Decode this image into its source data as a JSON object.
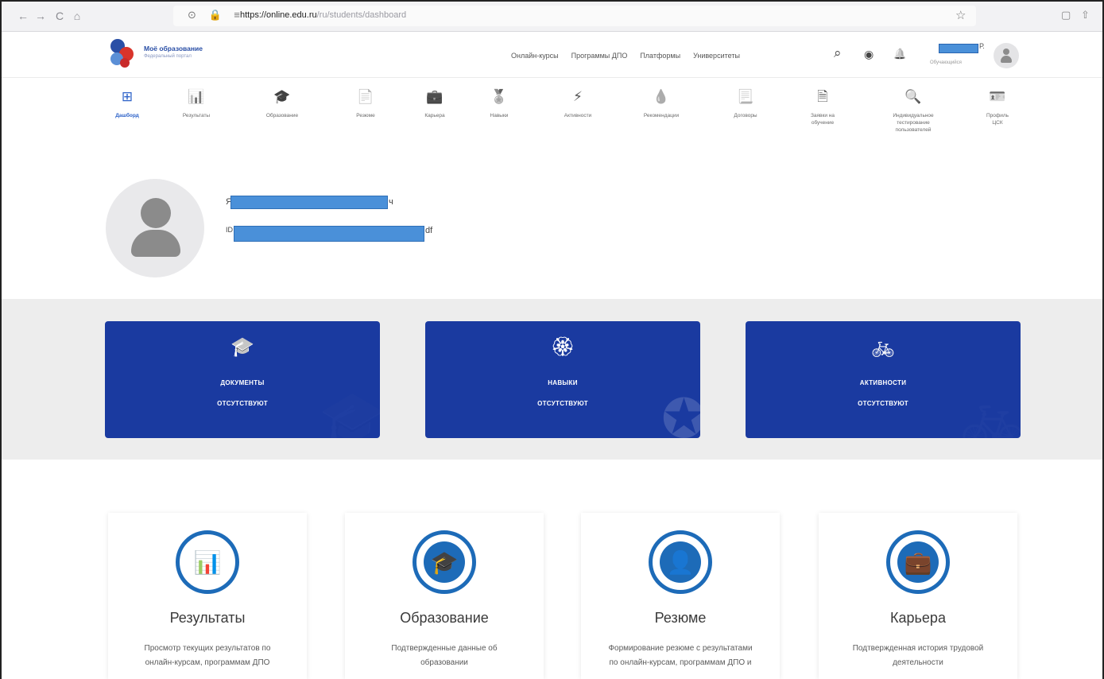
{
  "browser": {
    "back": "←",
    "forward": "→",
    "reload": "C",
    "home": "⌂",
    "url_lock": "⊙ 🔒 ≡",
    "url_host": "https://online.edu.ru",
    "url_path": "/ru/students/dashboard",
    "star": "☆",
    "ext1": "▢",
    "ext2": "⇧"
  },
  "header": {
    "logo_title": "Моё образование",
    "logo_subtitle": "Федеральный портал",
    "links": [
      "Онлайн-курсы",
      "Программы ДПО",
      "Платформы",
      "Университеты"
    ],
    "search_icon": "⌕",
    "eye_icon": "◉",
    "bell_icon": "🔔",
    "user_tail": "Р.",
    "user_role": "Обучающийся"
  },
  "tabs": [
    {
      "icon": "⊞",
      "label": "Дашборд",
      "active": true
    },
    {
      "icon": "📊",
      "label": "Результаты"
    },
    {
      "icon": "🎓",
      "label": "Образование"
    },
    {
      "icon": "📄",
      "label": "Резюме"
    },
    {
      "icon": "💼",
      "label": "Карьера"
    },
    {
      "icon": "🏅",
      "label": "Навыки"
    },
    {
      "icon": "⚡",
      "label": "Активности"
    },
    {
      "icon": "💧",
      "label": "Рекомендации"
    },
    {
      "icon": "📃",
      "label": "Договоры"
    },
    {
      "icon": "🗎",
      "label": "Заявки на обучение"
    },
    {
      "icon": "🔍",
      "label": "Индивидуальное тестирование пользователей"
    },
    {
      "icon": "🪪",
      "label": "Профиль ЦСК"
    }
  ],
  "profile": {
    "name_prefix": "Я",
    "name_suffix": "ч",
    "id_prefix": "ID",
    "id_suffix": "df"
  },
  "blue_cards": [
    {
      "icon": "🎓",
      "line1": "ДОКУМЕНТЫ",
      "line2": "ОТСУТСТВУЮТ",
      "ghost": "🎓"
    },
    {
      "icon": "🏵",
      "line1": "НАВЫКИ",
      "line2": "ОТСУТСТВУЮТ",
      "ghost": "✪"
    },
    {
      "icon": "🚲",
      "line1": "АКТИВНОСТИ",
      "line2": "ОТСУТСТВУЮТ",
      "ghost": "🚲"
    }
  ],
  "feature_cards": [
    {
      "icon": "📊",
      "title": "Результаты",
      "desc": "Просмотр текущих результатов по онлайн-курсам, программам ДПО"
    },
    {
      "icon": "🎓",
      "title": "Образование",
      "desc": "Подтвержденные данные об образовании"
    },
    {
      "icon": "👤",
      "title": "Резюме",
      "desc": "Формирование резюме с результатами по онлайн-курсам, программам ДПО и"
    },
    {
      "icon": "💼",
      "title": "Карьера",
      "desc": "Подтвержденная история трудовой деятельности"
    }
  ]
}
